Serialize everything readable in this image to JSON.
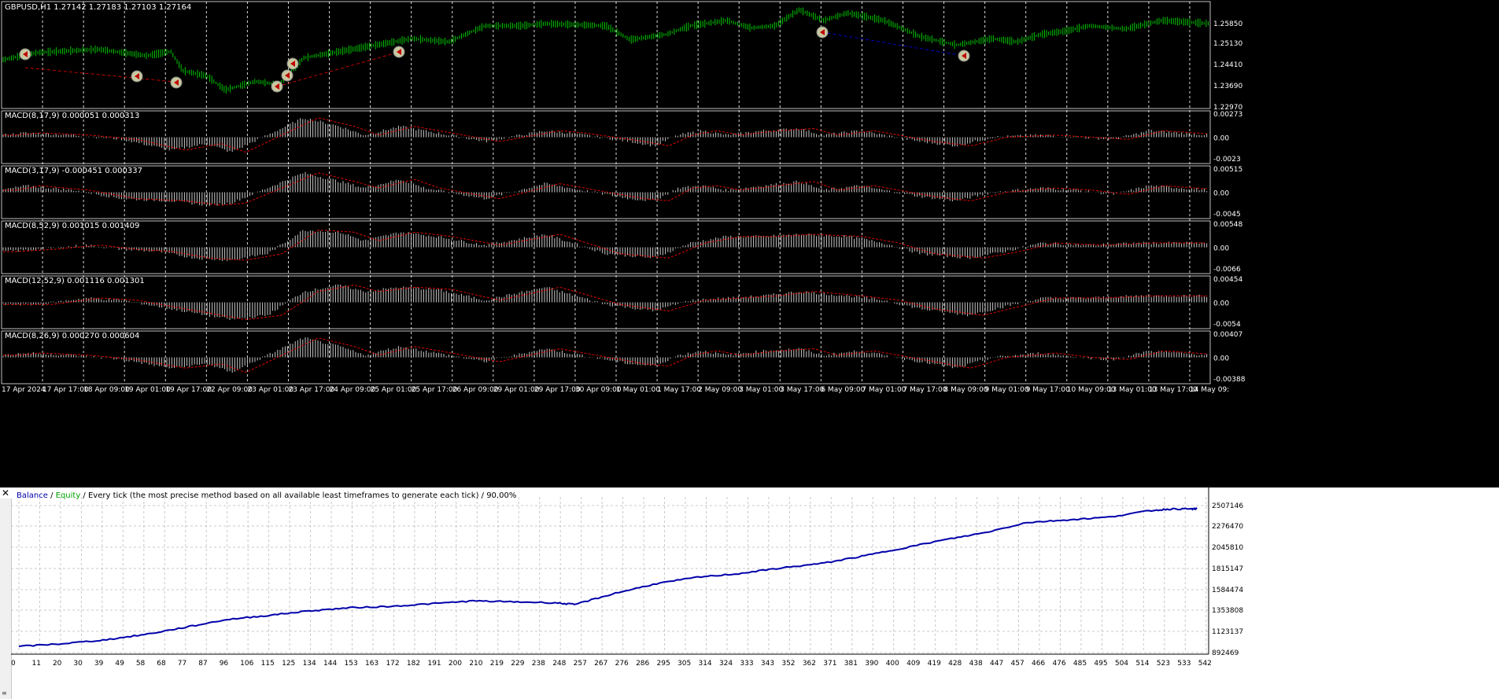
{
  "price_chart": {
    "symbol_info": "GBPUSD,H1  1.27142 1.27183 1.27103 1.27164",
    "price_labels": [
      "1.25850",
      "1.25130",
      "1.24410",
      "1.23690",
      "1.22970"
    ],
    "colors": {
      "bars": "#00c800",
      "background": "#000000",
      "grid": "#ffffff",
      "trend": "#c80000",
      "trend_blue": "#0000c8"
    }
  },
  "macd_panels": [
    {
      "label": "MACD(8,17,9) 0.000051 0.000313",
      "scale": [
        "0.00273",
        "0.00",
        "-0.0023"
      ]
    },
    {
      "label": "MACD(3,17,9) -0.000451 0.000337",
      "scale": [
        "0.00515",
        "0.00",
        "-0.0045"
      ]
    },
    {
      "label": "MACD(8,52,9) 0.001015 0.001409",
      "scale": [
        "0.00548",
        "0.00",
        "-0.0066"
      ]
    },
    {
      "label": "MACD(12,52,9) 0.001116 0.001301",
      "scale": [
        "0.00454",
        "0.00",
        "-0.0054"
      ]
    },
    {
      "label": "MACD(8,26,9) 0.000270 0.000604",
      "scale": [
        "0.00407",
        "0.00",
        "-0.00388"
      ]
    }
  ],
  "time_axis": [
    "17 Apr 2024",
    "17 Apr 17:00",
    "18 Apr 09:00",
    "19 Apr 01:00",
    "19 Apr 17:00",
    "22 Apr 09:00",
    "23 Apr 01:00",
    "23 Apr 17:00",
    "24 Apr 09:00",
    "25 Apr 01:00",
    "25 Apr 17:00",
    "26 Apr 09:00",
    "29 Apr 01:00",
    "29 Apr 17:00",
    "30 Apr 09:00",
    "1 May 01:00",
    "1 May 17:00",
    "2 May 09:00",
    "3 May 01:00",
    "3 May 17:00",
    "6 May 09:00",
    "7 May 01:00",
    "7 May 17:00",
    "8 May 09:00",
    "9 May 01:00",
    "9 May 17:00",
    "10 May 09:00",
    "13 May 01:00",
    "13 May 17:00",
    "14 May 09:"
  ],
  "tester": {
    "close_symbol": "✕",
    "legend_balance": "Balance",
    "legend_sep": " / ",
    "legend_equity": "Equity",
    "legend_rest": " / Every tick (the most precise method based on all available least timeframes to generate each tick) / 90.00%",
    "y_labels": [
      "2507146",
      "2276470",
      "2045810",
      "1815147",
      "1584474",
      "1353808",
      "1123137",
      "892469"
    ],
    "x_labels": [
      "0",
      "11",
      "20",
      "30",
      "39",
      "49",
      "58",
      "68",
      "77",
      "87",
      "96",
      "106",
      "115",
      "125",
      "134",
      "144",
      "153",
      "163",
      "172",
      "182",
      "191",
      "200",
      "210",
      "219",
      "229",
      "238",
      "248",
      "257",
      "267",
      "276",
      "286",
      "295",
      "305",
      "314",
      "324",
      "333",
      "343",
      "352",
      "362",
      "371",
      "381",
      "390",
      "400",
      "409",
      "419",
      "428",
      "438",
      "447",
      "457",
      "466",
      "476",
      "485",
      "495",
      "504",
      "514",
      "523",
      "533",
      "542"
    ],
    "colors": {
      "balance": "#0000aa",
      "equity": "#00a000",
      "grid": "#c8c8c8",
      "background": "#ffffff"
    }
  },
  "chart_data": {
    "type": "line",
    "title": "",
    "series": [
      {
        "name": "Balance",
        "x": [
          0,
          20,
          39,
          58,
          77,
          96,
          115,
          134,
          153,
          172,
          191,
          210,
          229,
          248,
          257,
          276,
          295,
          314,
          333,
          352,
          371,
          390,
          409,
          428,
          447,
          466,
          485,
          504,
          523,
          533,
          542,
          545
        ],
        "values": [
          960000,
          990000,
          1030000,
          1090000,
          1170000,
          1255000,
          1300000,
          1350000,
          1385000,
          1400000,
          1430000,
          1460000,
          1450000,
          1440000,
          1420000,
          1545000,
          1650000,
          1720000,
          1760000,
          1820000,
          1870000,
          1950000,
          2040000,
          2130000,
          2210000,
          2320000,
          2350000,
          2380000,
          2450000,
          2470000,
          2470000,
          2470000
        ]
      }
    ],
    "xlim": [
      0,
      549
    ],
    "ylim": [
      892469,
      2507146
    ]
  }
}
